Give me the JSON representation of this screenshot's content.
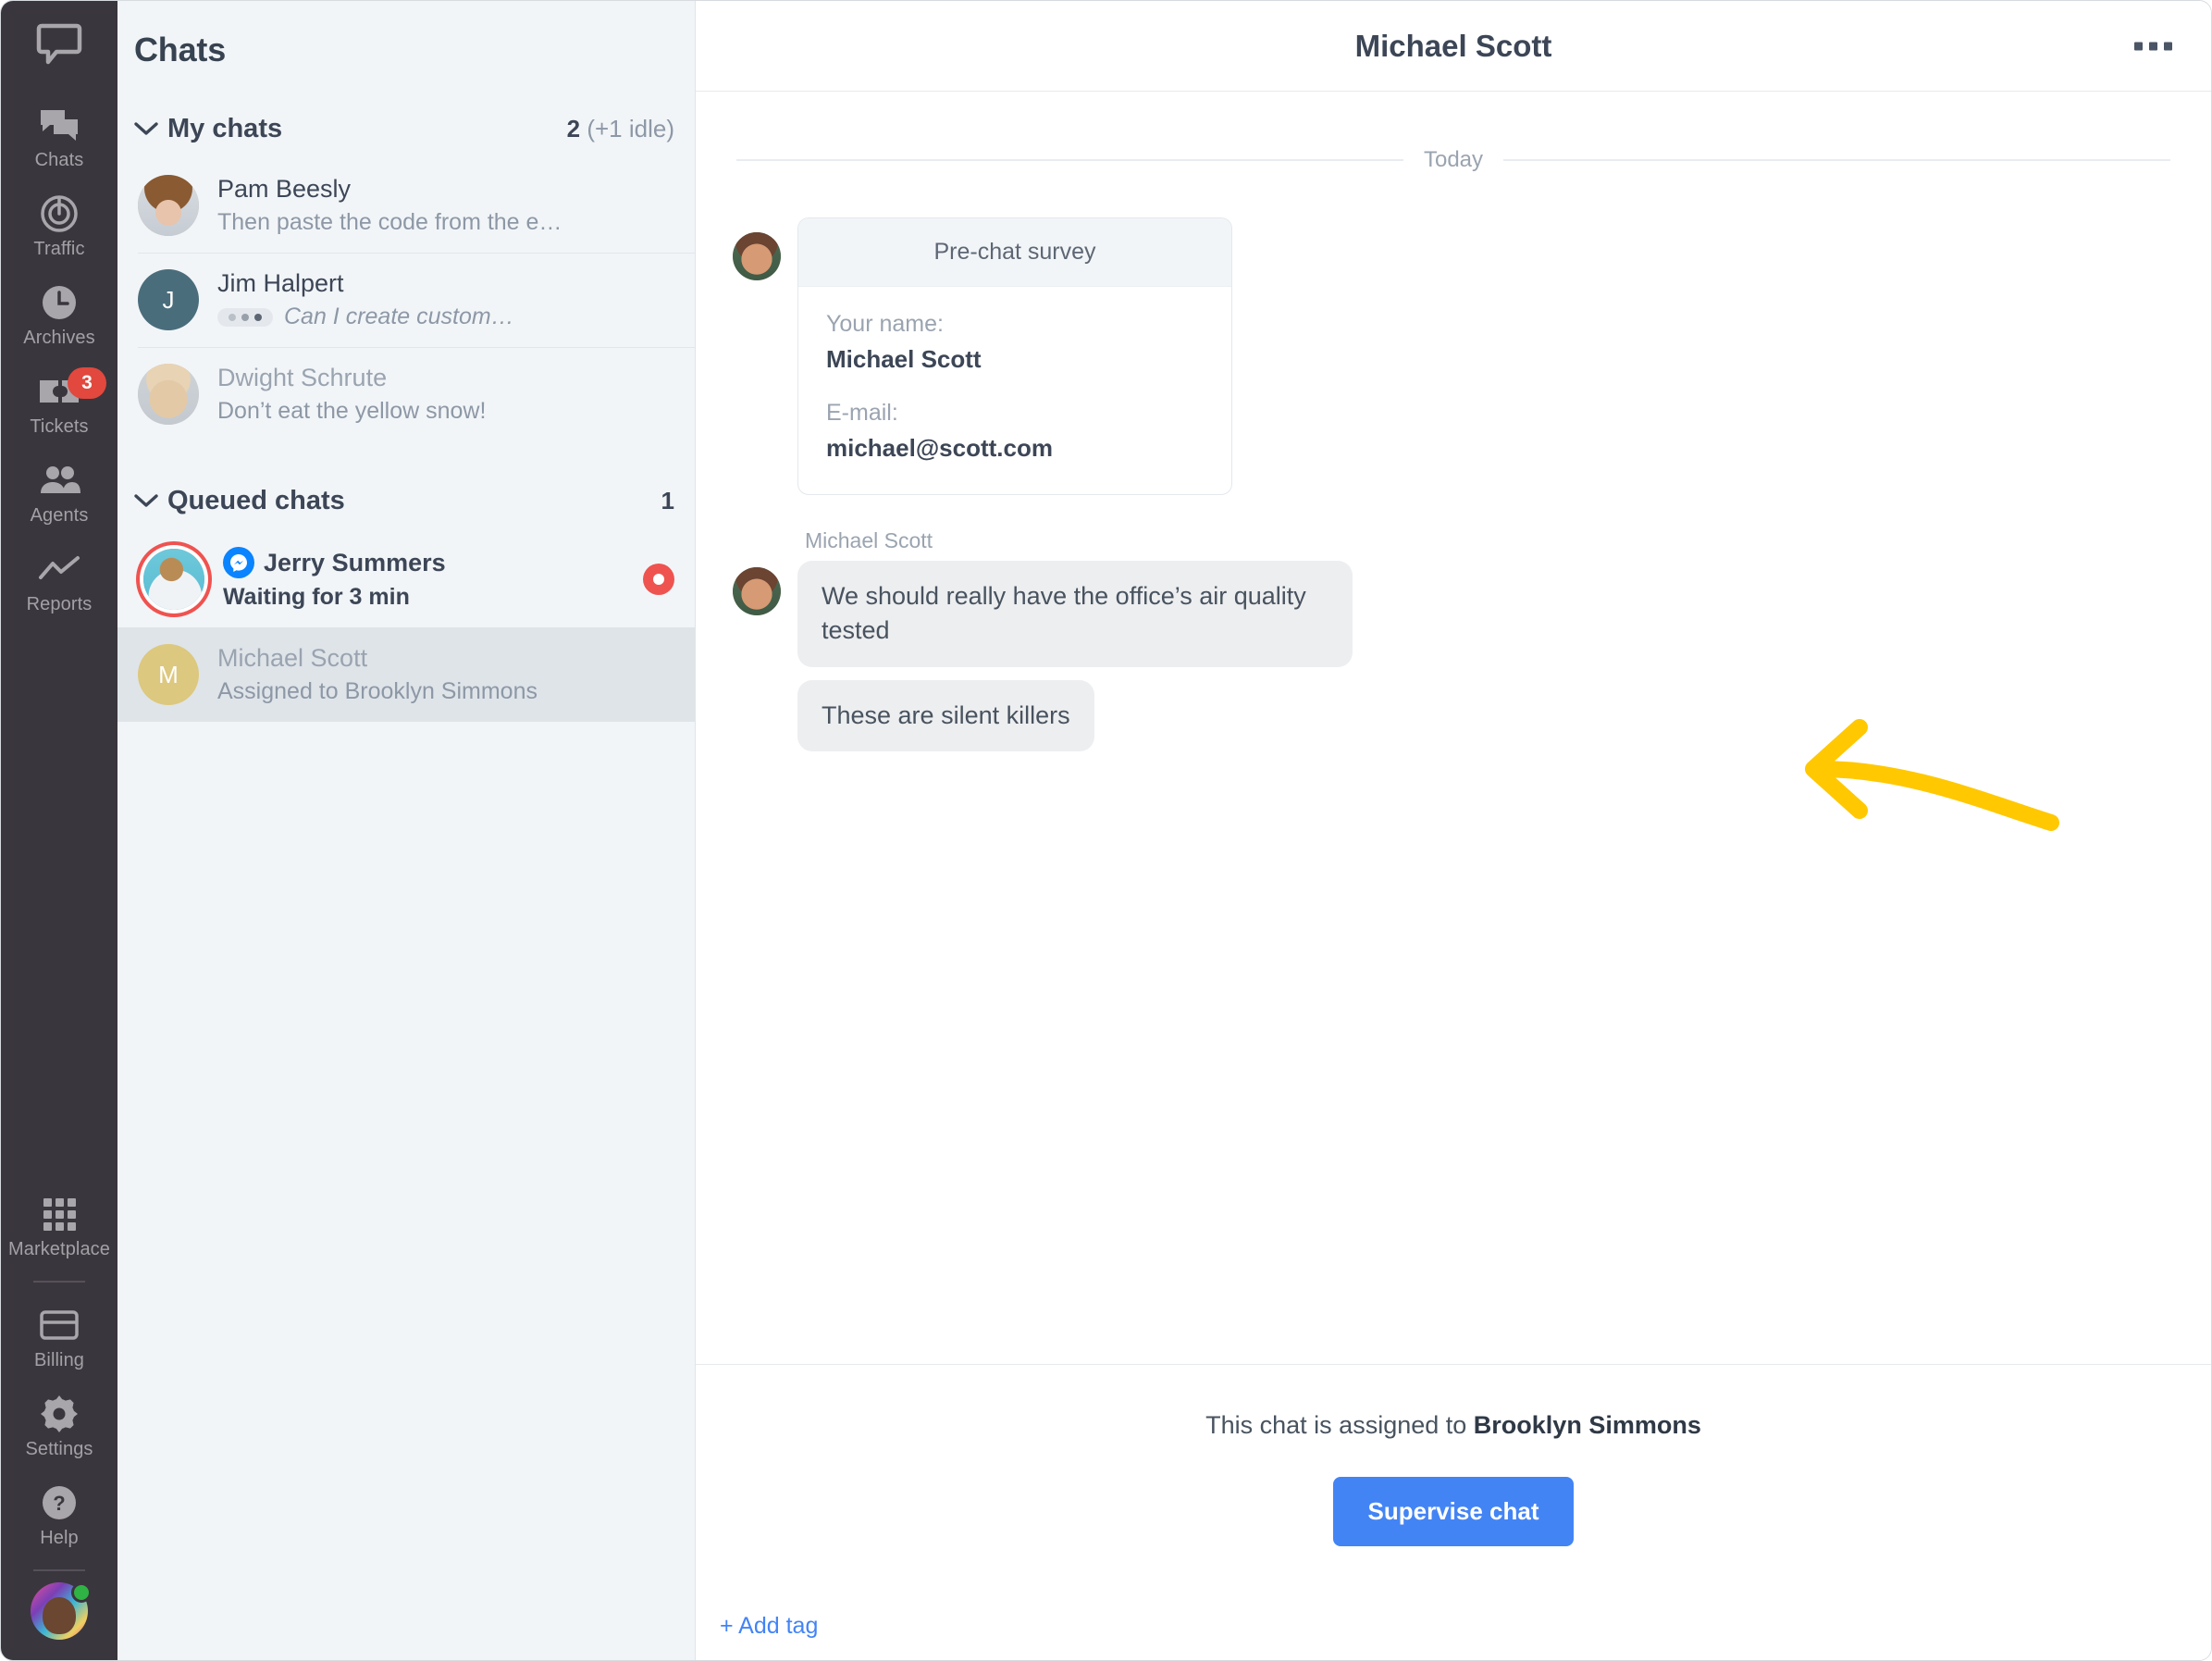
{
  "rail": {
    "logo_icon": "chat-logo-icon",
    "items": [
      {
        "label": "Chats",
        "icon": "chats-icon",
        "badge": null
      },
      {
        "label": "Traffic",
        "icon": "traffic-icon",
        "badge": null
      },
      {
        "label": "Archives",
        "icon": "archives-clock-icon",
        "badge": null
      },
      {
        "label": "Tickets",
        "icon": "tickets-icon",
        "badge": "3"
      },
      {
        "label": "Agents",
        "icon": "agents-icon",
        "badge": null
      },
      {
        "label": "Reports",
        "icon": "reports-chart-icon",
        "badge": null
      }
    ],
    "bottom_items": [
      {
        "label": "Marketplace",
        "icon": "marketplace-grid-icon"
      },
      {
        "label": "Billing",
        "icon": "billing-card-icon"
      },
      {
        "label": "Settings",
        "icon": "settings-gear-icon"
      },
      {
        "label": "Help",
        "icon": "help-question-icon"
      }
    ],
    "badge_color": "#e2483d",
    "background": "#3a363d"
  },
  "list": {
    "title": "Chats",
    "groups": [
      {
        "name": "My chats",
        "count": "2",
        "count_suffix": " (+1 idle)",
        "rows": [
          {
            "name": "Pam Beesly",
            "preview": "Then paste the code from the e…",
            "avatar": "pam-avatar",
            "typing": false,
            "muted": false
          },
          {
            "name": "Jim Halpert",
            "preview": "Can I create custom…",
            "avatar": "jim-avatar",
            "typing": true,
            "muted": false
          },
          {
            "name": "Dwight Schrute",
            "preview": "Don’t eat the yellow snow!",
            "avatar": "dwight-avatar",
            "typing": false,
            "muted": true
          }
        ]
      },
      {
        "name": "Queued chats",
        "count": "1",
        "count_suffix": "",
        "rows": [
          {
            "name": "Jerry Summers",
            "preview": "Waiting for 3 min",
            "avatar": "jerry-avatar",
            "channel": "messenger-icon",
            "unread": true,
            "muted": false
          },
          {
            "name": "Michael Scott",
            "preview": "Assigned to Brooklyn Simmons",
            "avatar": "michael-avatar",
            "selected": true,
            "muted": true
          }
        ]
      }
    ]
  },
  "main": {
    "title": "Michael Scott",
    "kebab_icon": "more-options-icon",
    "day_divider": "Today",
    "survey": {
      "header": "Pre-chat survey",
      "fields": [
        {
          "label": "Your name:",
          "value": "Michael Scott"
        },
        {
          "label": "E-mail:",
          "value": "michael@scott.com"
        }
      ]
    },
    "sender_name": "Michael Scott",
    "messages": [
      "We should really have the office’s air quality tested",
      "These are silent killers"
    ],
    "annotation_arrow": {
      "icon": "curved-arrow-annotation",
      "color": "#FFC800"
    },
    "footer": {
      "assigned_prefix": "This chat is assigned to ",
      "assigned_agent": "Brooklyn Simmons",
      "supervise_label": "Supervise chat",
      "supervise_color": "#4384f5",
      "add_tag_label": "+ Add tag"
    }
  }
}
